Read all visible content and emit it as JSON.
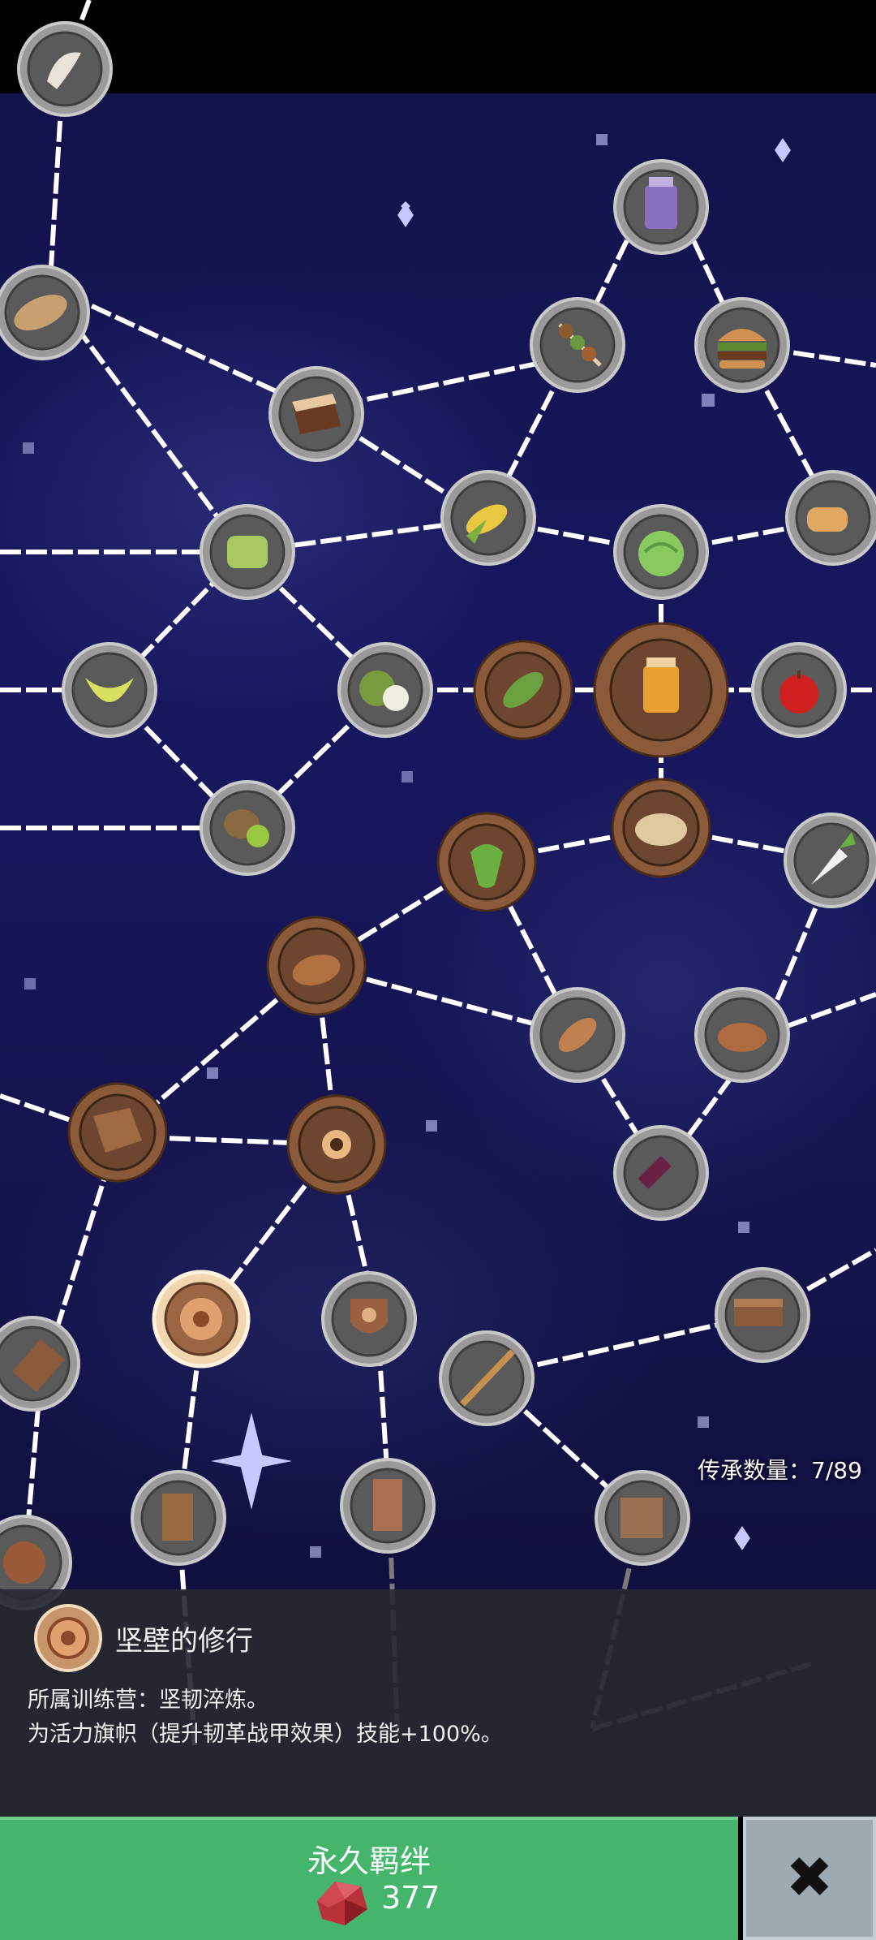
{
  "legacy": {
    "label": "传承数量：7/89"
  },
  "skill": {
    "title": "坚壁的修行",
    "camp_line": "所属训练营：坚韧淬炼。",
    "effect_line": "为活力旗帜（提升韧革战甲效果）技能+100%。"
  },
  "bond_button": {
    "label": "永久羁绊",
    "cost": "377"
  },
  "close_button": {
    "glyph": "✖"
  },
  "colors": {
    "bond_green": "#45b56b",
    "close_gray": "#9eaab2",
    "space_blue": "#181760"
  },
  "nodes": [
    {
      "name": "fish-fillet-icon"
    },
    {
      "name": "bread-loaf-icon"
    },
    {
      "name": "jam-jar-icon"
    },
    {
      "name": "kebab-icon"
    },
    {
      "name": "burger-icon"
    },
    {
      "name": "cake-slice-icon"
    },
    {
      "name": "corn-icon"
    },
    {
      "name": "baguette-icon"
    },
    {
      "name": "jelly-icon"
    },
    {
      "name": "cabbage-icon"
    },
    {
      "name": "melon-slice-icon"
    },
    {
      "name": "coconut-icon"
    },
    {
      "name": "leaf-icon"
    },
    {
      "name": "honey-jar-icon"
    },
    {
      "name": "apple-icon"
    },
    {
      "name": "kiwi-icon"
    },
    {
      "name": "pie-icon"
    },
    {
      "name": "green-pepper-icon"
    },
    {
      "name": "radish-icon"
    },
    {
      "name": "sausage-bread-icon"
    },
    {
      "name": "fried-fish-icon"
    },
    {
      "name": "steak-icon"
    },
    {
      "name": "bark-shield-icon"
    },
    {
      "name": "round-shield-icon"
    },
    {
      "name": "wine-bottle-icon"
    },
    {
      "name": "wooden-buckler-icon"
    },
    {
      "name": "crest-shield-icon"
    },
    {
      "name": "wood-block-icon"
    },
    {
      "name": "staff-icon"
    },
    {
      "name": "wooden-tower-shield-icon"
    },
    {
      "name": "wooden-door-icon"
    },
    {
      "name": "wooden-board-icon"
    },
    {
      "name": "wood-crate-icon"
    },
    {
      "name": "wooden-round-icon"
    }
  ]
}
